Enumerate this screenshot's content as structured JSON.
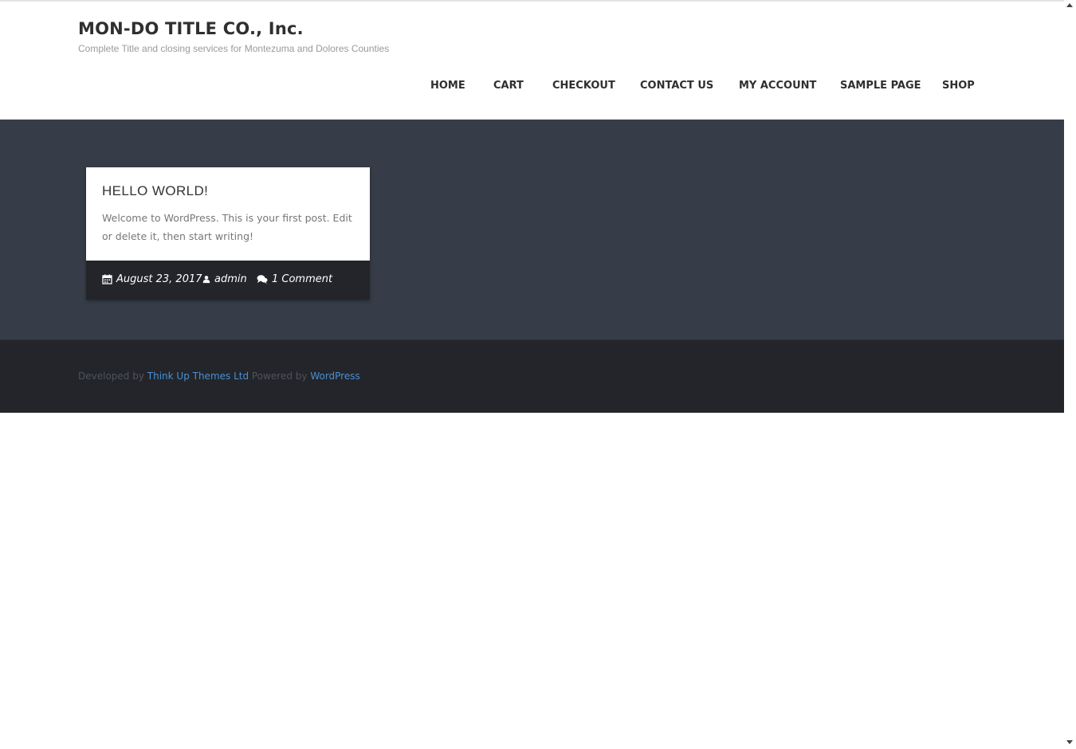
{
  "site": {
    "title": "MON-DO TITLE CO., Inc.",
    "tagline": "Complete Title and closing services for Montezuma and Dolores Counties"
  },
  "nav": {
    "items": [
      {
        "label": "HOME"
      },
      {
        "label": "CART"
      },
      {
        "label": "CHECKOUT"
      },
      {
        "label": "CONTACT US"
      },
      {
        "label": "MY ACCOUNT"
      },
      {
        "label": "SAMPLE PAGE"
      },
      {
        "label": "SHOP"
      }
    ]
  },
  "post": {
    "title": "HELLO WORLD!",
    "excerpt": "Welcome to WordPress. This is your first post. Edit or delete it, then start writing!",
    "date": "August 23, 2017",
    "author": "admin",
    "comments": "1 Comment"
  },
  "footer": {
    "developed_by_text": "Developed by",
    "developer_link": "Think Up Themes Ltd",
    "powered_by_text": "Powered by",
    "platform_link": "WordPress"
  },
  "colors": {
    "banner_bg": "#363d48",
    "footer_bg": "#23252a",
    "link": "#4a90d2",
    "nav_text": "#2f2f2f"
  },
  "icons": {
    "date": "calendar-icon",
    "author": "user-icon",
    "comments": "comments-icon"
  }
}
